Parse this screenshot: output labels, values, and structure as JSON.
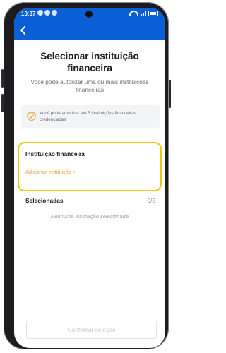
{
  "statusbar": {
    "time": "10:37"
  },
  "header": {
    "back_icon": "chevron-left-icon"
  },
  "page": {
    "title": "Selecionar instituição financeira",
    "subtitle": "Você pode autorizar uma ou mais instituições financeiras"
  },
  "info": {
    "icon": "shield-check-icon",
    "text": "Você pode autorizar até 5 instituições financeiras credenciadas"
  },
  "institution": {
    "label": "Instituição financeira",
    "add_link": "Adicionar instituição +"
  },
  "selected": {
    "label": "Selecionadas",
    "count": "0/5",
    "empty_text": "Nenhuma instituição selecionada."
  },
  "footer": {
    "confirm_label": "Confirmar seleção"
  },
  "colors": {
    "header": "#0a5ed6",
    "accent_link": "#e6a13b",
    "highlight_border": "#f4c317",
    "text_primary": "#1a1a1a",
    "text_secondary": "#6d6d72"
  }
}
